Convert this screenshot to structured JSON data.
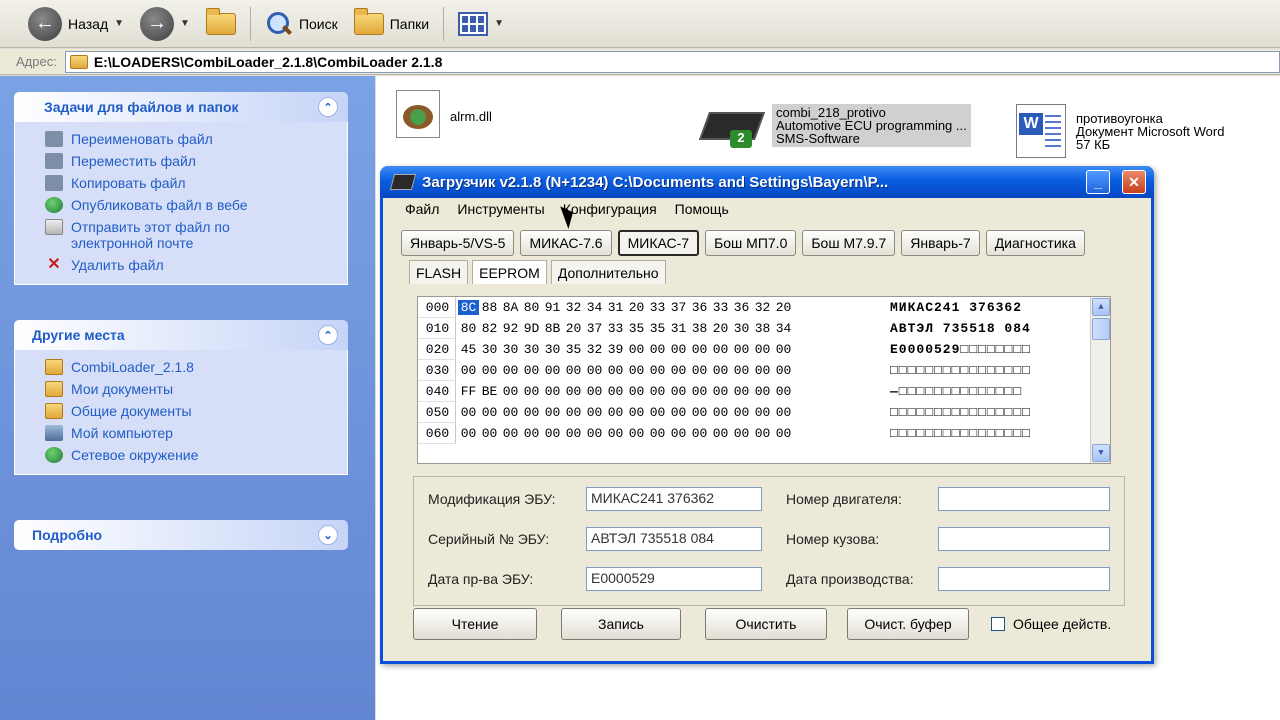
{
  "explorer": {
    "toolbar": {
      "back": "Назад",
      "search": "Поиск",
      "folders": "Папки"
    },
    "address": {
      "label": "Адрес:",
      "path": "E:\\LOADERS\\CombiLoader_2.1.8\\CombiLoader 2.1.8"
    },
    "tasks_panel": {
      "title": "Задачи для файлов и папок",
      "items": [
        "Переименовать файл",
        "Переместить файл",
        "Копировать файл",
        "Опубликовать файл в вебе",
        "Отправить этот файл по электронной почте",
        "Удалить файл"
      ]
    },
    "places_panel": {
      "title": "Другие места",
      "items": [
        "CombiLoader_2.1.8",
        "Мои документы",
        "Общие документы",
        "Мой компьютер",
        "Сетевое окружение"
      ]
    },
    "details_panel": {
      "title": "Подробно"
    },
    "files": [
      {
        "name": "alrm.dll",
        "icon": "dll-icon"
      },
      {
        "name": "combi_218_protivo",
        "line2": "Automotive ECU programming ...",
        "line3": "SMS-Software",
        "icon": "ecu-chip-icon"
      },
      {
        "name": "противоугонка",
        "line2": "Документ Microsoft Word",
        "line3": "57 КБ",
        "icon": "word-doc-icon"
      }
    ]
  },
  "loader": {
    "title": "Загрузчик v2.1.8 (N+1234) C:\\Documents and Settings\\Bayern\\P...",
    "menu": [
      "Файл",
      "Инструменты",
      "Конфигурация",
      "Помощь"
    ],
    "ecu_tabs": [
      "Январь-5/VS-5",
      "МИКАС-7.6",
      "МИКАС-7",
      "Бош МП7.0",
      "Бош М7.9.7",
      "Январь-7",
      "Диагностика"
    ],
    "active_ecu": "МИКАС-7",
    "sub_tabs": [
      "FLASH",
      "EEPROM",
      "Дополнительно"
    ],
    "active_sub": "EEPROM",
    "hex_rows": [
      {
        "addr": "000",
        "bytes": [
          "8C",
          "88",
          "8A",
          "80",
          "91",
          "32",
          "34",
          "31",
          "20",
          "33",
          "37",
          "36",
          "33",
          "36",
          "32",
          "20"
        ],
        "ascii": "МИКАС241 376362"
      },
      {
        "addr": "010",
        "bytes": [
          "80",
          "82",
          "92",
          "9D",
          "8B",
          "20",
          "37",
          "33",
          "35",
          "35",
          "31",
          "38",
          "20",
          "30",
          "38",
          "34"
        ],
        "ascii": "АВТЭЛ 735518 084"
      },
      {
        "addr": "020",
        "bytes": [
          "45",
          "30",
          "30",
          "30",
          "30",
          "35",
          "32",
          "39",
          "00",
          "00",
          "00",
          "00",
          "00",
          "00",
          "00",
          "00"
        ],
        "ascii": "E0000529□□□□□□□□"
      },
      {
        "addr": "030",
        "bytes": [
          "00",
          "00",
          "00",
          "00",
          "00",
          "00",
          "00",
          "00",
          "00",
          "00",
          "00",
          "00",
          "00",
          "00",
          "00",
          "00"
        ],
        "ascii": "□□□□□□□□□□□□□□□□"
      },
      {
        "addr": "040",
        "bytes": [
          "FF",
          "BE",
          "00",
          "00",
          "00",
          "00",
          "00",
          "00",
          "00",
          "00",
          "00",
          "00",
          "00",
          "00",
          "00",
          "00"
        ],
        "ascii": " ―□□□□□□□□□□□□□□"
      },
      {
        "addr": "050",
        "bytes": [
          "00",
          "00",
          "00",
          "00",
          "00",
          "00",
          "00",
          "00",
          "00",
          "00",
          "00",
          "00",
          "00",
          "00",
          "00",
          "00"
        ],
        "ascii": "□□□□□□□□□□□□□□□□"
      },
      {
        "addr": "060",
        "bytes": [
          "00",
          "00",
          "00",
          "00",
          "00",
          "00",
          "00",
          "00",
          "00",
          "00",
          "00",
          "00",
          "00",
          "00",
          "00",
          "00"
        ],
        "ascii": "□□□□□□□□□□□□□□□□"
      }
    ],
    "info": {
      "ecu_mod_label": "Модификация ЭБУ:",
      "ecu_mod_value": "МИКАС241 376362",
      "ecu_serial_label": "Серийный № ЭБУ:",
      "ecu_serial_value": "АВТЭЛ 735518 084",
      "ecu_date_label": "Дата пр-ва ЭБУ:",
      "ecu_date_value": "E0000529",
      "engine_no_label": "Номер двигателя:",
      "engine_no_value": "",
      "body_no_label": "Номер кузова:",
      "body_no_value": "",
      "prod_date_label": "Дата производства:",
      "prod_date_value": ""
    },
    "buttons": {
      "read": "Чтение",
      "write": "Запись",
      "clear": "Очистить",
      "clear_buffer": "Очист. буфер"
    },
    "checkbox": {
      "label": "Общее действ.",
      "checked": false
    }
  }
}
